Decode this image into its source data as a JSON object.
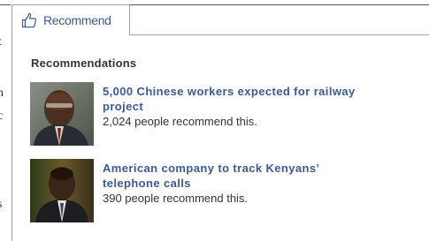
{
  "recommend_button": {
    "label": "Recommend",
    "icon": "thumbs-up-icon"
  },
  "panel": {
    "heading": "Recommendations",
    "items": [
      {
        "title": "5,000 Chinese workers expected for railway project",
        "count_text": "2,024 people recommend this.",
        "thumbnail": "man-portrait-photo"
      },
      {
        "title": "American company to track Kenyans’ telephone calls",
        "count_text": "390 people recommend this.",
        "thumbnail": "man-portrait-photo"
      }
    ]
  },
  "background_snippets": {
    "row1": "t",
    "row2": "n",
    "row3": "c",
    "row4": "s",
    "row5": ","
  },
  "colors": {
    "link": "#3b5998",
    "border": "#9aa3b6",
    "text": "#333333"
  }
}
